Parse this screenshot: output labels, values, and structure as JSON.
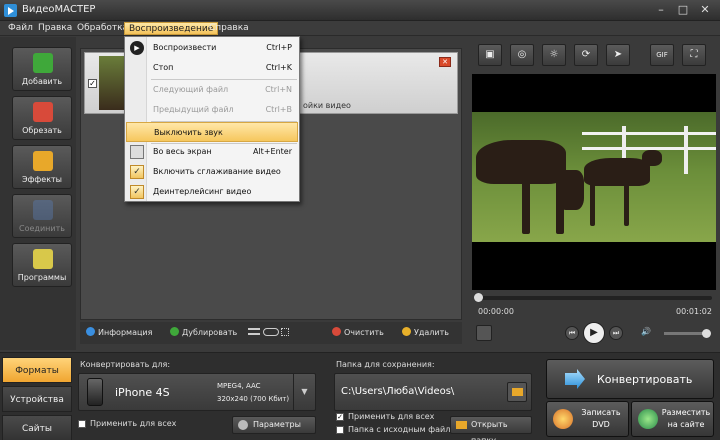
{
  "window": {
    "title": "ВидеоМАСТЕР",
    "minimize": "–",
    "maximize": "□",
    "close": "✕"
  },
  "menubar": {
    "items": [
      "Файл",
      "Правка",
      "Обработка",
      "Воспроизведение",
      "Справка"
    ]
  },
  "playback_menu": {
    "items": [
      {
        "label": "Воспроизвести",
        "shortcut": "Ctrl+P",
        "icon": "play-icon",
        "disabled": false
      },
      {
        "label": "Стоп",
        "shortcut": "Ctrl+K",
        "icon": "",
        "disabled": false
      },
      {
        "label": "Следующий файл",
        "shortcut": "Ctrl+N",
        "icon": "",
        "disabled": true
      },
      {
        "label": "Предыдущий файл",
        "shortcut": "Ctrl+B",
        "icon": "",
        "disabled": true
      },
      {
        "label": "Выключить звук",
        "shortcut": "",
        "icon": "",
        "disabled": false
      },
      {
        "label": "Во весь экран",
        "shortcut": "Alt+Enter",
        "icon": "fullscreen-icon",
        "disabled": false
      },
      {
        "label": "Включить сглаживание видео",
        "shortcut": "",
        "icon": "check-icon",
        "disabled": false
      },
      {
        "label": "Деинтерлейсинг видео",
        "shortcut": "",
        "icon": "check-icon",
        "disabled": false
      }
    ],
    "check_mark": "✓"
  },
  "sidebar": {
    "items": [
      {
        "label": "Добавить",
        "icon": "add-file-icon",
        "color": "#3fa83a"
      },
      {
        "label": "Обрезать",
        "icon": "scissors-icon",
        "color": "#d84a3a"
      },
      {
        "label": "Эффекты",
        "icon": "effects-icon",
        "color": "#e8a82a"
      },
      {
        "label": "Соединить",
        "icon": "join-icon",
        "color": "#5a7fb8"
      },
      {
        "label": "Программы",
        "icon": "programs-icon",
        "color": "#d8c84a"
      }
    ]
  },
  "file_list": {
    "item_hint": "ойки видео",
    "check_mark": "✓",
    "close_mark": "✕"
  },
  "list_toolbar": {
    "info": "Информация",
    "duplicate": "Дублировать",
    "clear": "Очистить",
    "delete": "Удалить"
  },
  "preview": {
    "tools": [
      "crop-icon",
      "stabilize-icon",
      "brightness-icon",
      "rotate-icon",
      "speed-icon",
      "gif-icon",
      "fullscreen-icon"
    ],
    "gif_label": "GIF",
    "time_start": "00:00:00",
    "time_end": "00:01:02",
    "seek_progress": 0,
    "volume_level": 0.85
  },
  "tabs": [
    "Форматы",
    "Устройства",
    "Сайты"
  ],
  "convert_for": {
    "label": "Конвертировать для:",
    "device": "iPhone 4S",
    "spec_line1": "MPEG4, AAC",
    "spec_line2": "320x240 (700 Кбит)",
    "apply_all": "Применить для всех",
    "params": "Параметры"
  },
  "save_folder": {
    "label": "Папка для сохранения:",
    "path": "C:\\Users\\Люба\\Videos\\",
    "apply_all": "Применить для всех",
    "source_folder": "Папка с исходным файлом",
    "open_folder": "Открыть папку"
  },
  "actions": {
    "convert": "Конвертировать",
    "burn_dvd_l1": "Записать",
    "burn_dvd_l2": "DVD",
    "publish_l1": "Разместить",
    "publish_l2": "на сайте"
  },
  "colors": {
    "accent": "#f0a530",
    "highlight": "#f6c75e"
  }
}
